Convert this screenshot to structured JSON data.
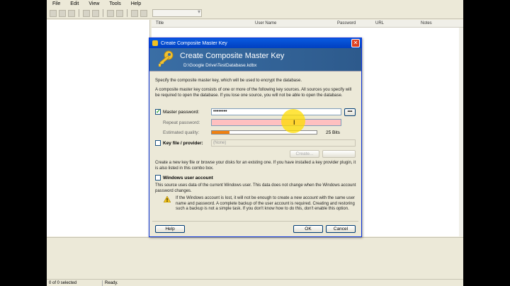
{
  "menu": [
    "File",
    "Edit",
    "View",
    "Tools",
    "Help"
  ],
  "columns": [
    "Title",
    "User Name",
    "Password",
    "URL",
    "Notes"
  ],
  "status": {
    "selected": "0 of 0 selected",
    "state": "Ready."
  },
  "dialog": {
    "window_title": "Create Composite Master Key",
    "banner_title": "Create Composite Master Key",
    "db_path": "D:\\Google Drive\\TestDatabase.kdbx",
    "intro": "Specify the composite master key, which will be used to encrypt the database.",
    "desc": "A composite master key consists of one or more of the following key sources. All sources you specify will be required to open the database.  If you lose one source, you will not be able to open the database.",
    "master_password_label": "Master password:",
    "master_password_value": "••••••••",
    "dots_button": "•••",
    "repeat_password_label": "Repeat password:",
    "estimated_quality_label": "Estimated quality:",
    "quality_bits": "25 Bits",
    "quality_fraction": 0.17,
    "keyfile_label": "Key file / provider:",
    "keyfile_value": "(None)",
    "create_button": "Create...",
    "keyfile_desc": "Create a new key file or browse your disks for an existing one. If you have installed a key provider plugin, it is also listed in this combo box.",
    "windows_account_label": "Windows user account",
    "windows_account_desc": "This source uses data of the current Windows user. This data does not change when the Windows account password changes.",
    "warning_text": "If the Windows account is lost, it will not be enough to create a new account with the same user name and password. A complete backup of the user account is required. Creating and restoring such a backup is not a simple task. If you don't know how to do this, don't enable this option.",
    "help_button": "Help",
    "ok_button": "OK",
    "cancel_button": "Cancel"
  }
}
